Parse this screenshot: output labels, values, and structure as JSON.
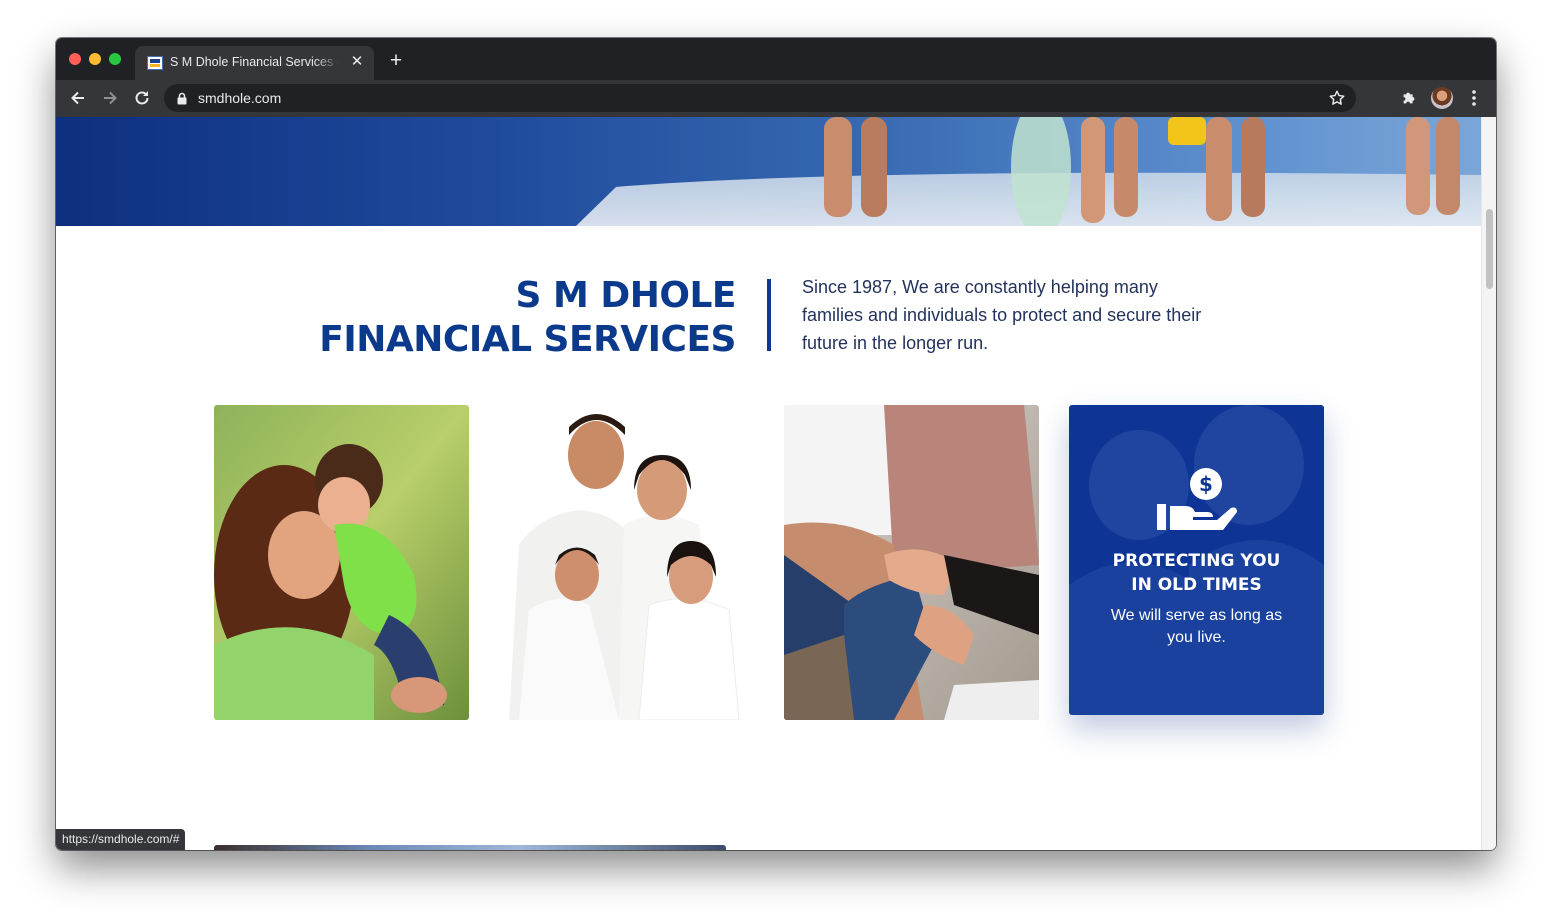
{
  "browser": {
    "tab_title": "S M Dhole Financial Services - Insurance Advisor",
    "url": "smdhole.com",
    "status_url": "https://smdhole.com/#"
  },
  "page": {
    "brand_line1": "S M DHOLE",
    "brand_line2": "FINANCIAL SERVICES",
    "tagline": "Since 1987, We are constantly helping many families and individuals to protect and secure their future in the longer run.",
    "card": {
      "title_line1": "PROTECTING YOU",
      "title_line2": "IN OLD TIMES",
      "text": "We will serve as long as you live.",
      "icon": "hand-dollar-icon"
    },
    "photos": [
      {
        "name": "photo-mother-child"
      },
      {
        "name": "photo-family"
      },
      {
        "name": "photo-handshake"
      }
    ]
  },
  "colors": {
    "brand_blue": "#0b3a8c",
    "card_blue": "#0e3595",
    "browser_dark": "#202124",
    "browser_toolbar": "#35363a"
  }
}
